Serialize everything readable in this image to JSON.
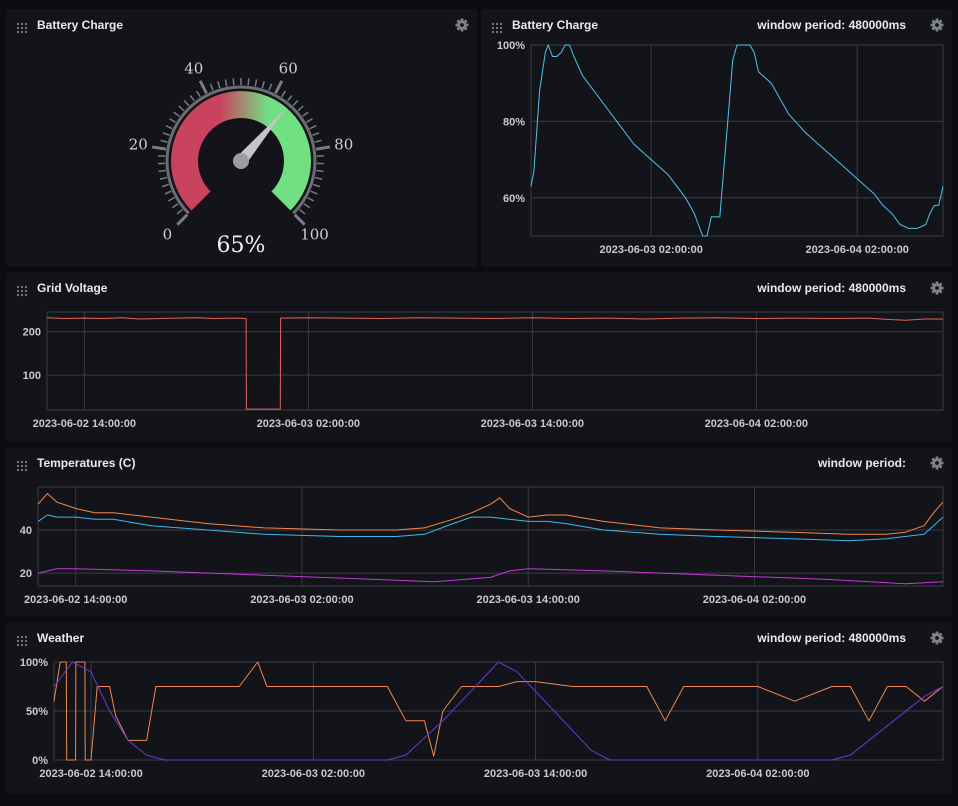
{
  "colors": {
    "background": "#0b0b11",
    "panel": "#131419",
    "grid": "#3a3b44",
    "battery_line": "#4fc3ec",
    "grid_voltage_line": "#e0635c",
    "temp_orange": "#f5874a",
    "temp_blue": "#3fb8ea",
    "temp_purple": "#c23ad6",
    "weather_orange": "#f08652",
    "weather_purple": "#6a37d8",
    "gauge_low": "#c9425e",
    "gauge_high": "#71e083"
  },
  "icons": {
    "drag": "drag-handle-icon",
    "settings": "gear-icon"
  },
  "panels": {
    "gauge": {
      "title": "Battery Charge"
    },
    "battery": {
      "title": "Battery Charge",
      "meta": "window period: 480000ms"
    },
    "voltage": {
      "title": "Grid Voltage",
      "meta": "window period: 480000ms"
    },
    "temps": {
      "title": "Temperatures (C)",
      "meta": "window period:"
    },
    "weather": {
      "title": "Weather",
      "meta": "window period: 480000ms"
    }
  },
  "chart_data": [
    {
      "id": "gauge",
      "type": "gauge",
      "value": 65,
      "value_label": "65%",
      "min": 0,
      "max": 100,
      "tick_labels": [
        "0",
        "20",
        "40",
        "60",
        "80",
        "100"
      ]
    },
    {
      "id": "battery",
      "type": "line",
      "xlim": [
        "2023-06-02 12:00:00",
        "2023-06-04 12:00:00"
      ],
      "ylim": [
        50,
        100
      ],
      "y_ticks": [
        "60%",
        "80%",
        "100%"
      ],
      "x_ticks": [
        "2023-06-03 02:00:00",
        "2023-06-04 02:00:00"
      ],
      "series": [
        {
          "x": [
            "2023-06-02 12:00",
            "2023-06-02 12:20",
            "2023-06-02 13:00",
            "2023-06-02 13:40",
            "2023-06-02 14:00",
            "2023-06-02 14:30",
            "2023-06-02 15:00",
            "2023-06-02 15:30",
            "2023-06-02 16:00",
            "2023-06-02 16:30",
            "2023-06-02 17:00",
            "2023-06-02 18:00",
            "2023-06-02 20:00",
            "2023-06-02 22:00",
            "2023-06-03 00:00",
            "2023-06-03 02:00",
            "2023-06-03 04:00",
            "2023-06-03 05:00",
            "2023-06-03 06:00",
            "2023-06-03 07:00",
            "2023-06-03 07:30",
            "2023-06-03 08:00",
            "2023-06-03 08:30",
            "2023-06-03 09:00",
            "2023-06-03 09:30",
            "2023-06-03 10:00",
            "2023-06-03 11:00",
            "2023-06-03 11:30",
            "2023-06-03 12:00",
            "2023-06-03 12:30",
            "2023-06-03 13:00",
            "2023-06-03 13:30",
            "2023-06-03 14:00",
            "2023-06-03 14:30",
            "2023-06-03 15:00",
            "2023-06-03 15:30",
            "2023-06-03 16:00",
            "2023-06-03 17:00",
            "2023-06-03 18:00",
            "2023-06-03 20:00",
            "2023-06-03 22:00",
            "2023-06-04 00:00",
            "2023-06-04 02:00",
            "2023-06-04 04:00",
            "2023-06-04 05:00",
            "2023-06-04 06:00",
            "2023-06-04 07:00",
            "2023-06-04 08:00",
            "2023-06-04 09:00",
            "2023-06-04 10:00",
            "2023-06-04 10:30",
            "2023-06-04 11:00",
            "2023-06-04 11:30",
            "2023-06-04 12:00"
          ],
          "y": [
            63,
            67,
            88,
            98,
            100,
            97,
            97,
            98,
            100,
            100,
            97,
            92,
            86,
            80,
            74,
            70,
            66,
            63,
            60,
            56,
            53,
            50,
            50,
            55,
            55,
            55,
            82,
            96,
            100,
            100,
            100,
            100,
            98,
            93,
            92,
            91,
            90,
            86,
            82,
            77,
            73,
            69,
            65,
            61,
            58,
            56,
            53,
            52,
            52,
            53,
            56,
            58,
            58,
            63
          ]
        }
      ]
    },
    {
      "id": "voltage",
      "type": "line",
      "xlim": [
        "2023-06-02 12:00:00",
        "2023-06-04 12:00:00"
      ],
      "ylim": [
        20,
        245
      ],
      "y_ticks": [
        "100",
        "200"
      ],
      "x_ticks": [
        "2023-06-02 14:00:00",
        "2023-06-03 02:00:00",
        "2023-06-03 14:00:00",
        "2023-06-04 02:00:00"
      ],
      "series": [
        {
          "x": [
            "2023-06-02 12:00",
            "2023-06-02 13:00",
            "2023-06-02 14:00",
            "2023-06-02 15:00",
            "2023-06-02 16:00",
            "2023-06-02 17:00",
            "2023-06-02 18:00",
            "2023-06-02 19:00",
            "2023-06-02 20:00",
            "2023-06-02 21:00",
            "2023-06-02 22:00",
            "2023-06-02 22:40",
            "2023-06-02 22:41",
            "2023-06-02 23:00",
            "2023-06-03 00:00",
            "2023-06-03 00:30",
            "2023-06-03 00:31",
            "2023-06-03 02:00",
            "2023-06-03 04:00",
            "2023-06-03 06:00",
            "2023-06-03 08:00",
            "2023-06-03 10:00",
            "2023-06-03 12:00",
            "2023-06-03 14:00",
            "2023-06-03 16:00",
            "2023-06-03 18:00",
            "2023-06-03 20:00",
            "2023-06-03 22:00",
            "2023-06-04 00:00",
            "2023-06-04 02:00",
            "2023-06-04 04:00",
            "2023-06-04 06:00",
            "2023-06-04 08:00",
            "2023-06-04 09:00",
            "2023-06-04 10:00",
            "2023-06-04 11:00",
            "2023-06-04 12:00"
          ],
          "y": [
            232,
            230,
            231,
            230,
            232,
            229,
            230,
            231,
            232,
            230,
            231,
            230,
            22,
            22,
            22,
            22,
            231,
            232,
            231,
            230,
            232,
            231,
            230,
            232,
            230,
            231,
            229,
            231,
            232,
            230,
            231,
            230,
            231,
            228,
            226,
            229,
            229
          ]
        }
      ]
    },
    {
      "id": "temps",
      "type": "line",
      "xlim": [
        "2023-06-02 12:00:00",
        "2023-06-04 12:00:00"
      ],
      "ylim": [
        14,
        60
      ],
      "y_ticks": [
        "20",
        "40"
      ],
      "x_ticks": [
        "2023-06-02 14:00:00",
        "2023-06-03 02:00:00",
        "2023-06-03 14:00:00",
        "2023-06-04 02:00:00"
      ],
      "series": [
        {
          "x": [
            "2023-06-02 12:00",
            "2023-06-02 12:30",
            "2023-06-02 13:00",
            "2023-06-02 14:00",
            "2023-06-02 15:00",
            "2023-06-02 16:00",
            "2023-06-02 18:00",
            "2023-06-02 21:00",
            "2023-06-03 00:00",
            "2023-06-03 04:00",
            "2023-06-03 07:00",
            "2023-06-03 08:30",
            "2023-06-03 10:00",
            "2023-06-03 11:00",
            "2023-06-03 12:00",
            "2023-06-03 12:30",
            "2023-06-03 13:00",
            "2023-06-03 14:00",
            "2023-06-03 15:00",
            "2023-06-03 16:00",
            "2023-06-03 18:00",
            "2023-06-03 21:00",
            "2023-06-04 00:00",
            "2023-06-04 04:00",
            "2023-06-04 07:00",
            "2023-06-04 09:00",
            "2023-06-04 10:00",
            "2023-06-04 11:00",
            "2023-06-04 11:30",
            "2023-06-04 12:00"
          ],
          "y": [
            52,
            57,
            53,
            50,
            48,
            48,
            46,
            43,
            41,
            40,
            40,
            41,
            45,
            48,
            52,
            55,
            50,
            46,
            47,
            47,
            44,
            41,
            40,
            39,
            38,
            38,
            39,
            42,
            48,
            53
          ]
        },
        {
          "x": [
            "2023-06-02 12:00",
            "2023-06-02 12:30",
            "2023-06-02 13:00",
            "2023-06-02 14:00",
            "2023-06-02 15:00",
            "2023-06-02 16:00",
            "2023-06-02 18:00",
            "2023-06-02 21:00",
            "2023-06-03 00:00",
            "2023-06-03 04:00",
            "2023-06-03 07:00",
            "2023-06-03 08:30",
            "2023-06-03 10:00",
            "2023-06-03 11:00",
            "2023-06-03 12:00",
            "2023-06-03 13:00",
            "2023-06-03 14:00",
            "2023-06-03 15:00",
            "2023-06-03 16:00",
            "2023-06-03 18:00",
            "2023-06-03 21:00",
            "2023-06-04 00:00",
            "2023-06-04 04:00",
            "2023-06-04 07:00",
            "2023-06-04 09:00",
            "2023-06-04 10:00",
            "2023-06-04 11:00",
            "2023-06-04 11:30",
            "2023-06-04 12:00"
          ],
          "y": [
            44,
            47,
            46,
            46,
            45,
            45,
            42,
            40,
            38,
            37,
            37,
            38,
            43,
            46,
            46,
            45,
            44,
            44,
            43,
            40,
            38,
            37,
            36,
            35,
            36,
            37,
            38,
            42,
            46
          ]
        },
        {
          "x": [
            "2023-06-02 12:00",
            "2023-06-02 13:00",
            "2023-06-02 14:00",
            "2023-06-02 18:00",
            "2023-06-03 00:00",
            "2023-06-03 06:00",
            "2023-06-03 09:00",
            "2023-06-03 12:00",
            "2023-06-03 13:00",
            "2023-06-03 14:00",
            "2023-06-03 18:00",
            "2023-06-04 00:00",
            "2023-06-04 06:00",
            "2023-06-04 10:00",
            "2023-06-04 12:00"
          ],
          "y": [
            20,
            22,
            22,
            21,
            19,
            17,
            16,
            18,
            21,
            22,
            21,
            19,
            17,
            15,
            16
          ]
        }
      ]
    },
    {
      "id": "weather",
      "type": "line",
      "xlim": [
        "2023-06-02 12:00:00",
        "2023-06-04 12:00:00"
      ],
      "ylim": [
        0,
        100
      ],
      "y_ticks": [
        "0%",
        "50%",
        "100%"
      ],
      "x_ticks": [
        "2023-06-02 14:00:00",
        "2023-06-03 02:00:00",
        "2023-06-03 14:00:00",
        "2023-06-04 02:00:00"
      ],
      "series": [
        {
          "x": [
            "2023-06-02 12:00",
            "2023-06-02 12:20",
            "2023-06-02 12:40",
            "2023-06-02 12:41",
            "2023-06-02 13:10",
            "2023-06-02 13:11",
            "2023-06-02 13:40",
            "2023-06-02 13:41",
            "2023-06-02 14:00",
            "2023-06-02 14:20",
            "2023-06-02 15:00",
            "2023-06-02 15:20",
            "2023-06-02 16:00",
            "2023-06-02 17:00",
            "2023-06-02 17:30",
            "2023-06-02 20:00",
            "2023-06-02 22:00",
            "2023-06-02 23:00",
            "2023-06-02 23:30",
            "2023-06-03 00:00",
            "2023-06-03 02:00",
            "2023-06-03 04:00",
            "2023-06-03 06:00",
            "2023-06-03 07:00",
            "2023-06-03 08:00",
            "2023-06-03 08:30",
            "2023-06-03 09:00",
            "2023-06-03 10:00",
            "2023-06-03 11:00",
            "2023-06-03 12:00",
            "2023-06-03 13:00",
            "2023-06-03 14:00",
            "2023-06-03 16:00",
            "2023-06-03 18:00",
            "2023-06-03 20:00",
            "2023-06-03 21:00",
            "2023-06-03 22:00",
            "2023-06-04 00:00",
            "2023-06-04 02:00",
            "2023-06-04 04:00",
            "2023-06-04 06:00",
            "2023-06-04 07:00",
            "2023-06-04 08:00",
            "2023-06-04 09:00",
            "2023-06-04 10:00",
            "2023-06-04 11:00",
            "2023-06-04 12:00"
          ],
          "y": [
            60,
            100,
            100,
            0,
            0,
            100,
            100,
            0,
            0,
            75,
            75,
            45,
            20,
            20,
            75,
            75,
            75,
            100,
            75,
            75,
            75,
            75,
            75,
            40,
            40,
            4,
            50,
            75,
            75,
            75,
            80,
            80,
            75,
            75,
            75,
            40,
            75,
            75,
            75,
            60,
            75,
            75,
            40,
            75,
            75,
            60,
            75
          ]
        },
        {
          "x": [
            "2023-06-02 12:00",
            "2023-06-02 13:00",
            "2023-06-02 14:00",
            "2023-06-02 15:00",
            "2023-06-02 16:00",
            "2023-06-02 17:00",
            "2023-06-02 18:00",
            "2023-06-03 00:00",
            "2023-06-03 06:00",
            "2023-06-03 07:00",
            "2023-06-03 09:00",
            "2023-06-03 11:00",
            "2023-06-03 12:00",
            "2023-06-03 13:00",
            "2023-06-03 15:00",
            "2023-06-03 17:00",
            "2023-06-03 18:00",
            "2023-06-04 00:00",
            "2023-06-04 06:00",
            "2023-06-04 07:00",
            "2023-06-04 09:00",
            "2023-06-04 11:00",
            "2023-06-04 12:00"
          ],
          "y": [
            75,
            100,
            90,
            50,
            20,
            5,
            0,
            0,
            0,
            5,
            40,
            80,
            100,
            90,
            50,
            10,
            0,
            0,
            0,
            5,
            35,
            65,
            75
          ]
        }
      ]
    }
  ]
}
